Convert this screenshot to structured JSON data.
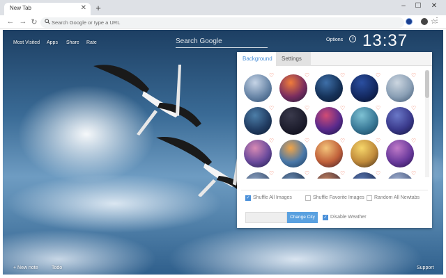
{
  "browser": {
    "tab_title": "New Tab",
    "omnibox_placeholder": "Search Google or type a URL"
  },
  "top_links": [
    "Most Visited",
    "Apps",
    "Share",
    "Rate"
  ],
  "search": {
    "placeholder": "Search Google"
  },
  "options_label": "Options",
  "clock": "13:37",
  "panel": {
    "tabs": [
      {
        "label": "Background",
        "active": true
      },
      {
        "label": "Settings",
        "active": false
      }
    ],
    "thumbnails": [
      {
        "colors": [
          "#c6d4e6",
          "#6a87a8",
          "#2a4a70"
        ]
      },
      {
        "colors": [
          "#f07c3b",
          "#7a2d5f",
          "#1a1a38"
        ]
      },
      {
        "colors": [
          "#3e6fa8",
          "#16335a",
          "#0a1630"
        ]
      },
      {
        "colors": [
          "#2b4fa0",
          "#142a62",
          "#060d24"
        ]
      },
      {
        "colors": [
          "#ccd6e0",
          "#8a9fb5",
          "#3c5470"
        ]
      },
      {
        "colors": [
          "#4c7ea8",
          "#223e64",
          "#0c1a30"
        ]
      },
      {
        "colors": [
          "#3a3a4c",
          "#1e1e2e",
          "#0a0a12"
        ]
      },
      {
        "colors": [
          "#d24c74",
          "#5a2a8c",
          "#161640"
        ]
      },
      {
        "colors": [
          "#7ec2d4",
          "#3a7a98",
          "#143a52"
        ]
      },
      {
        "colors": [
          "#6a78c8",
          "#3a3a8c",
          "#141438"
        ]
      },
      {
        "colors": [
          "#d88ab4",
          "#6a4a9c",
          "#1c1c48"
        ]
      },
      {
        "colors": [
          "#f0a448",
          "#4a78a8",
          "#1a3a5c"
        ]
      },
      {
        "colors": [
          "#f4c47a",
          "#c0603a",
          "#3a1e2a"
        ]
      },
      {
        "colors": [
          "#f6d66a",
          "#c08a3a",
          "#3a2a1a"
        ]
      },
      {
        "colors": [
          "#c07ac8",
          "#6a3a9c",
          "#24104a"
        ]
      },
      {
        "colors": [
          "#8aa0c0",
          "#4a6080",
          "#1c2a40"
        ]
      },
      {
        "colors": [
          "#6a8ab0",
          "#304868",
          "#101c2c"
        ]
      },
      {
        "colors": [
          "#c08060",
          "#604040",
          "#201818"
        ]
      },
      {
        "colors": [
          "#5a78b0",
          "#2a3c68",
          "#0c1428"
        ]
      },
      {
        "colors": [
          "#a0b0d0",
          "#5a6a90",
          "#20283c"
        ]
      }
    ],
    "options": [
      {
        "label": "Shuffle All Images",
        "checked": true
      },
      {
        "label": "Shuffle Favorite Images",
        "checked": false
      },
      {
        "label": "Random All Newtabs",
        "checked": false
      }
    ],
    "change_city_label": "Change City",
    "disable_weather_label": "Disable Weather",
    "disable_weather_checked": true
  },
  "bottom_links": {
    "new_note": "+ New note",
    "todo": "Todo",
    "support": "Support"
  },
  "colors": {
    "accent": "#4a90d9",
    "heart": "#f06a4a",
    "button": "#5aa1e0"
  }
}
